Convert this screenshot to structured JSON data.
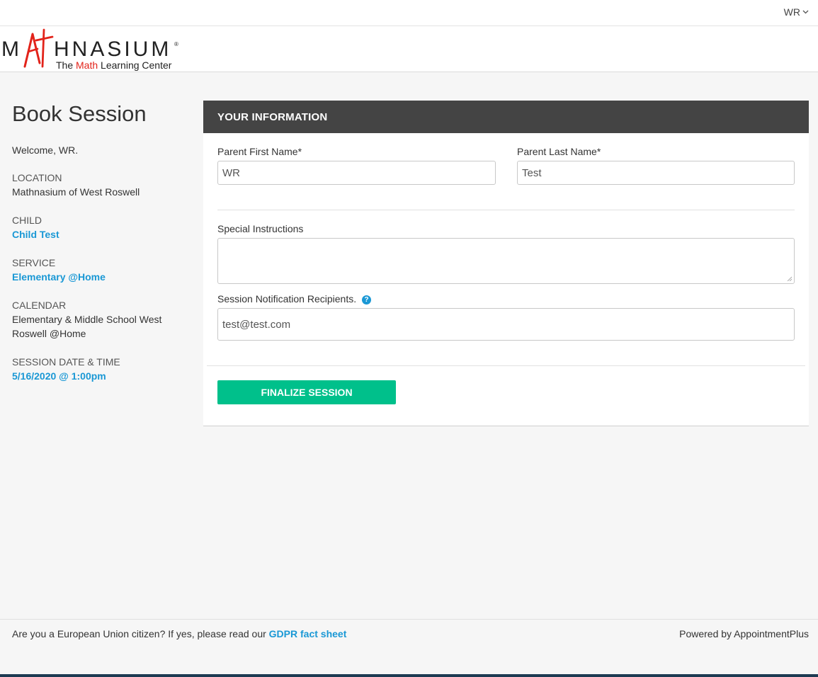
{
  "header": {
    "user_label": "WR"
  },
  "brand": {
    "name_pre": "M",
    "name_a": "A",
    "name_post": "HNASIUM",
    "tagline_pre": "The ",
    "tagline_highlight": "Math",
    "tagline_post": " Learning Center",
    "registered_mark": "®",
    "accent_color": "#e2231a"
  },
  "sidebar": {
    "title": "Book Session",
    "welcome": "Welcome, WR.",
    "location": {
      "label": "LOCATION",
      "value": "Mathnasium of West Roswell"
    },
    "child": {
      "label": "CHILD",
      "value": "Child Test"
    },
    "service": {
      "label": "SERVICE",
      "value": "Elementary @Home"
    },
    "calendar": {
      "label": "CALENDAR",
      "value": "Elementary & Middle School West Roswell @Home"
    },
    "session": {
      "label": "SESSION DATE & TIME",
      "value": "5/16/2020 @ 1:00pm"
    }
  },
  "form": {
    "header": "YOUR INFORMATION",
    "first_name": {
      "label": "Parent First Name*",
      "value": "WR"
    },
    "last_name": {
      "label": "Parent Last Name*",
      "value": "Test"
    },
    "special_instructions": {
      "label": "Special Instructions",
      "value": ""
    },
    "recipients": {
      "label": "Session Notification Recipients.",
      "value": "test@test.com",
      "help_icon": "question-circle-icon"
    },
    "finalize_label": "FINALIZE SESSION"
  },
  "footer": {
    "eu_text": "Are you a European Union citizen? If yes, please read our ",
    "gdpr_link": "GDPR fact sheet",
    "powered_by": "Powered by AppointmentPlus"
  },
  "colors": {
    "link": "#1a98d5",
    "header_bg": "#444444",
    "button_bg": "#00c08b",
    "brand_red": "#e2231a"
  }
}
